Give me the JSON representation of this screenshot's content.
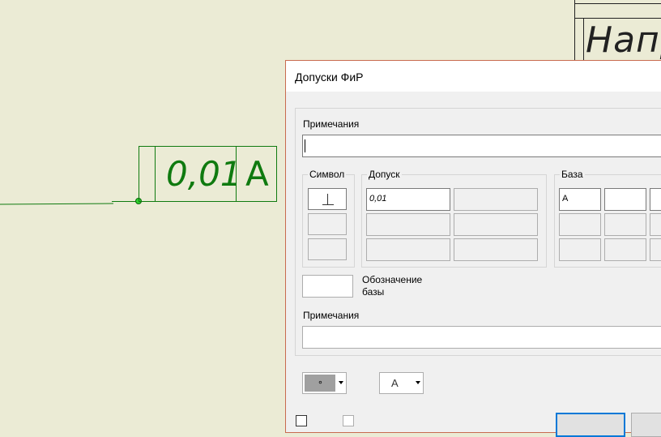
{
  "drawing": {
    "fcf_tolerance": "0,01",
    "fcf_datum": "A",
    "title_block_text": "Напр",
    "colors": {
      "background": "#ebebd5",
      "annotation": "#0f7a0f",
      "leader_dot": "#2fcf2f"
    }
  },
  "dialog": {
    "title": "Допуски ФиР",
    "notes_top_label": "Примечания",
    "notes_top_value": "",
    "symbol_group": {
      "label": "Символ",
      "buttons": [
        {
          "icon": "perpendicularity-icon",
          "selected": true
        },
        {
          "icon": "",
          "selected": false
        },
        {
          "icon": "",
          "selected": false
        }
      ]
    },
    "tolerance_group": {
      "label": "Допуск",
      "rows": [
        [
          "0,01",
          ""
        ],
        [
          "",
          ""
        ],
        [
          "",
          ""
        ]
      ]
    },
    "datum_group": {
      "label": "База",
      "rows": [
        [
          "A",
          "",
          ""
        ],
        [
          "",
          "",
          ""
        ],
        [
          "",
          "",
          ""
        ]
      ]
    },
    "datum_identifier": {
      "label_line1": "Обозначение",
      "label_line2": "базы",
      "value": ""
    },
    "notes_bottom_label": "Примечания",
    "notes_bottom_value": "",
    "projected_zone_combo": {
      "glyph": "∘"
    },
    "text_style_combo": {
      "value": "A"
    },
    "colors": {
      "border": "#c86b4f",
      "face": "#f0f0f0"
    }
  }
}
